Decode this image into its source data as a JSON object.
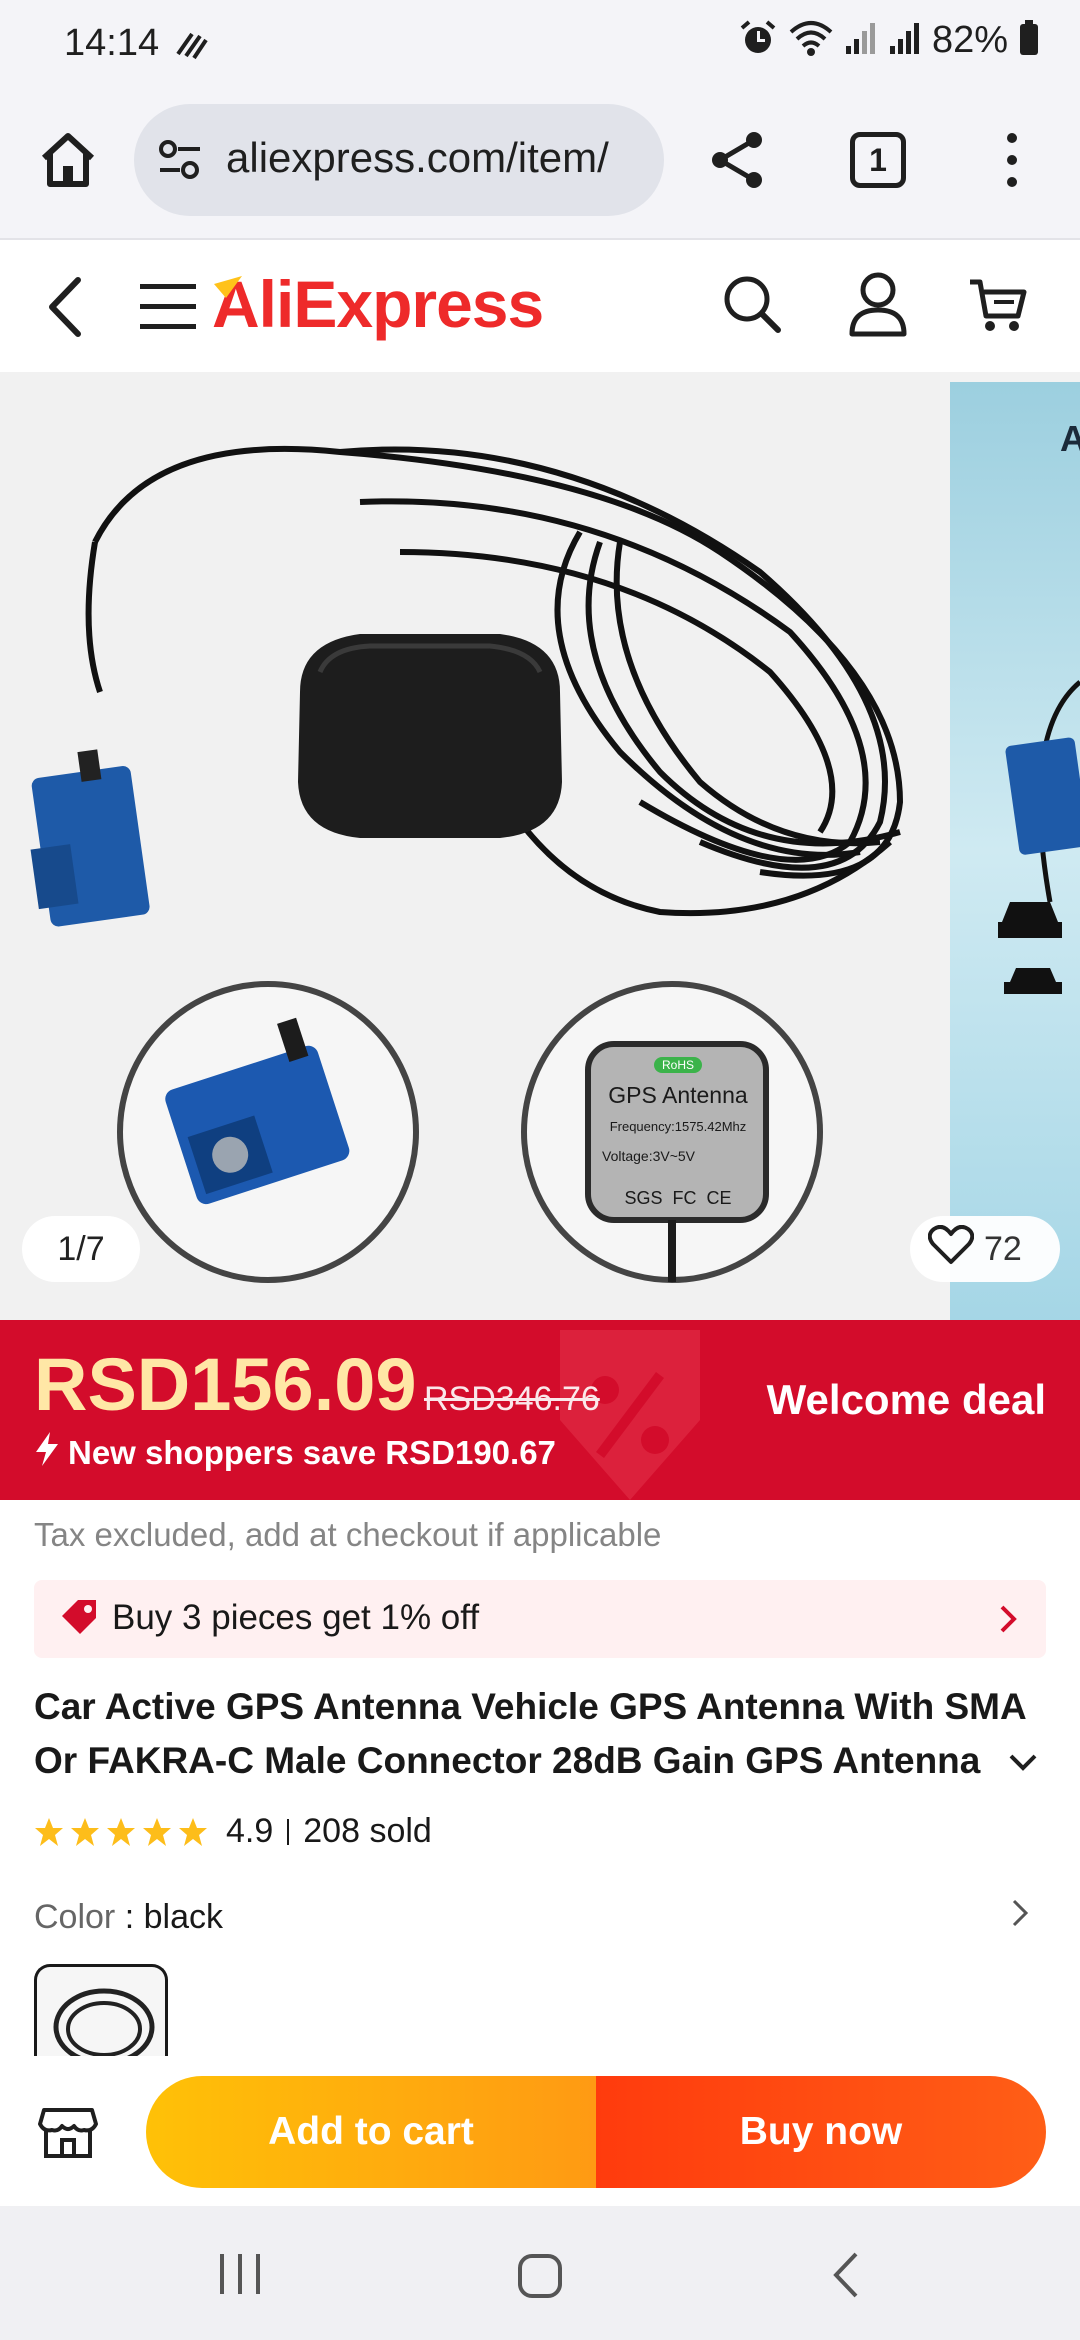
{
  "status_bar": {
    "time": "14:14",
    "battery": "82%"
  },
  "browser": {
    "url": "aliexpress.com/item/",
    "tab_count": "1"
  },
  "header": {
    "logo": "AliExpress"
  },
  "gallery": {
    "counter": "1/7",
    "wishlist_count": "72",
    "image_label": "GPS Antenna",
    "image_freq": "Frequency:1575.42Mhz",
    "image_voltage": "Voltage:3V~5V",
    "image_marks": "SGS  FC  CE",
    "image_badge": "RoHS",
    "next_image_letter": "A"
  },
  "price": {
    "current": "RSD156.09",
    "original": "RSD346.76",
    "savings": "New shoppers save RSD190.67",
    "deal_label": "Welcome deal"
  },
  "tax_note": "Tax excluded, add at checkout if applicable",
  "promo": {
    "text": "Buy 3 pieces get 1% off"
  },
  "product": {
    "title": "Car Active GPS Antenna Vehicle GPS Antenna With SMA Or FAKRA-C Male Connector 28dB Gain GPS Antenna",
    "rating": "4.9",
    "sold": "208 sold",
    "color_label": "Color",
    "color_value": "black"
  },
  "actions": {
    "add_to_cart": "Add to cart",
    "buy_now": "Buy now"
  },
  "colors": {
    "brand_red": "#ee2a2a",
    "banner_red": "#d30c2b",
    "price_yellow": "#ffe7a6",
    "star_yellow": "#fdbd1a",
    "add_cart_orange": "#ffb20e",
    "buy_now_red": "#ff4a12"
  }
}
